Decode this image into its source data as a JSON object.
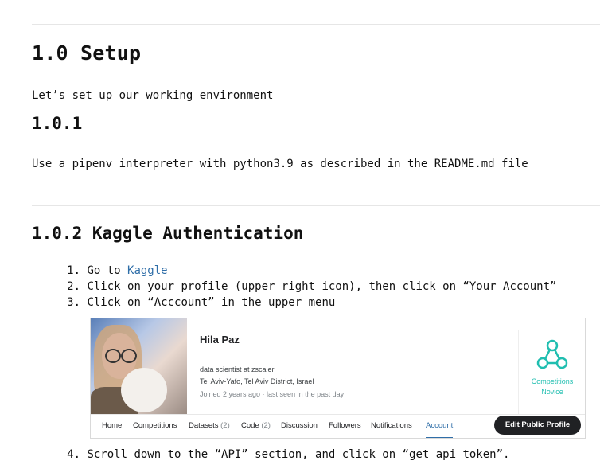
{
  "setup": {
    "title": "1.0 Setup",
    "intro": "Let’s set up our working environment"
  },
  "section_101": {
    "title": "1.0.1",
    "text": "Use a pipenv interpreter with python3.9 as described in the README.md file"
  },
  "section_102": {
    "title": "1.0.2 Kaggle Authentication",
    "steps": [
      {
        "num": "1.",
        "prefix": "Go to ",
        "link": "Kaggle"
      },
      {
        "num": "2.",
        "text": "Click on your profile (upper right icon), then click on “Your Account”"
      },
      {
        "num": "3.",
        "text": "Click on “Acccount” in the upper menu"
      },
      {
        "num": "4.",
        "text": "Scroll down to the “API” section, and click on “get api token”."
      }
    ]
  },
  "profile": {
    "name": "Hila Paz",
    "headline": "data scientist at zscaler",
    "location": "Tel Aviv-Yafo, Tel Aviv District, Israel",
    "joined": "Joined 2 years ago · last seen in the past day",
    "tier_line1": "Competitions",
    "tier_line2": "Novice",
    "tier_color": "#20beb0",
    "tabs": {
      "home": "Home",
      "competitions": "Competitions",
      "datasets": "Datasets",
      "datasets_count": "(2)",
      "code": "Code",
      "code_count": "(2)",
      "discussion": "Discussion",
      "followers": "Followers",
      "notifications": "Notifications",
      "account": "Account"
    },
    "edit_button": "Edit Public Profile"
  }
}
